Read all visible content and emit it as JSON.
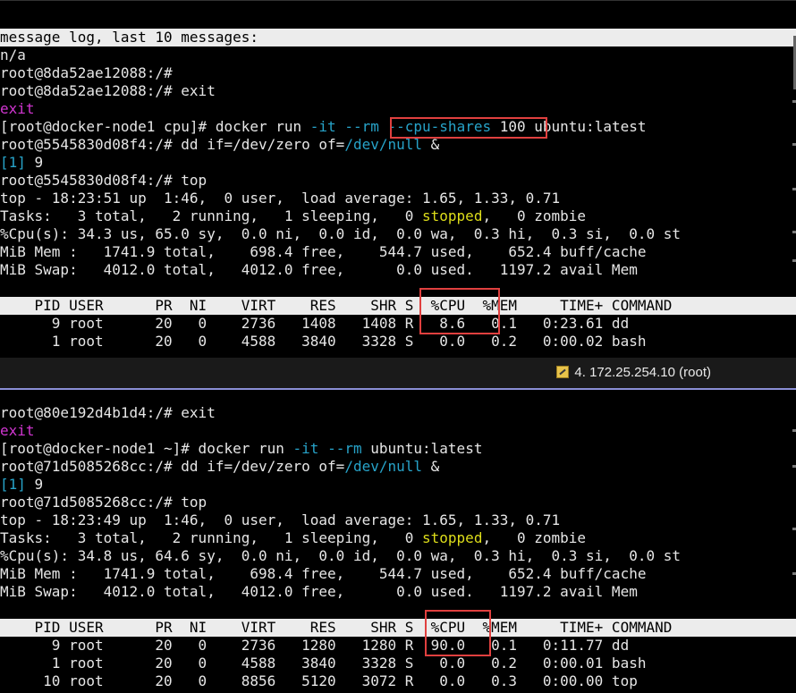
{
  "window": {
    "tab_label": "4. 172.25.254.10 (root)",
    "tab_icon": "terminal-key-icon"
  },
  "top_pane": {
    "lines": [
      {
        "text": "message log, last 10 messages:",
        "style": "hdr"
      },
      {
        "text": "n/a"
      },
      {
        "text": "root@8da52ae12088:/#"
      },
      {
        "text": "root@8da52ae12088:/# exit"
      },
      {
        "text": "exit",
        "style": "magenta"
      },
      {
        "segments": [
          {
            "text": "[root@docker-node1 cpu]# docker run "
          },
          {
            "text": "-it",
            "style": "cyan"
          },
          {
            "text": " "
          },
          {
            "text": "--rm",
            "style": "cyan"
          },
          {
            "text": " "
          },
          {
            "text": "--cpu-shares",
            "style": "cyan"
          },
          {
            "text": " 100 ubuntu:latest"
          }
        ]
      },
      {
        "segments": [
          {
            "text": "root@5545830d08f4:/# dd if=/dev/zero of="
          },
          {
            "text": "/dev/null",
            "style": "cyan"
          },
          {
            "text": " &"
          }
        ]
      },
      {
        "segments": [
          {
            "text": "[1]",
            "style": "cyan"
          },
          {
            "text": " 9"
          }
        ]
      },
      {
        "text": "root@5545830d08f4:/# top"
      },
      {
        "text": "top - 18:23:51 up  1:46,  0 user,  load average: 1.65, 1.33, 0.71"
      },
      {
        "segments": [
          {
            "text": "Tasks:   3 total,   2 running,   1 sleeping,   0 "
          },
          {
            "text": "stopped",
            "style": "yellow"
          },
          {
            "text": ",   0 zombie"
          }
        ]
      },
      {
        "text": "%Cpu(s): 34.3 us, 65.0 sy,  0.0 ni,  0.0 id,  0.0 wa,  0.3 hi,  0.3 si,  0.0 st"
      },
      {
        "text": "MiB Mem :   1741.9 total,    698.4 free,    544.7 used,    652.4 buff/cache"
      },
      {
        "text": "MiB Swap:   4012.0 total,   4012.0 free,      0.0 used.   1197.2 avail Mem"
      },
      {
        "text": ""
      },
      {
        "text": "    PID USER      PR  NI    VIRT    RES    SHR S  %CPU  %MEM     TIME+ COMMAND",
        "style": "hdr"
      },
      {
        "text": "      9 root      20   0    2736   1408   1408 R   8.6   0.1   0:23.61 dd"
      },
      {
        "text": "      1 root      20   0    4588   3840   3328 S   0.0   0.2   0:00.02 bash"
      }
    ]
  },
  "bottom_pane": {
    "lines": [
      {
        "text": "root@80e192d4b1d4:/# exit"
      },
      {
        "text": "exit",
        "style": "magenta"
      },
      {
        "segments": [
          {
            "text": "[root@docker-node1 ~]# docker run "
          },
          {
            "text": "-it",
            "style": "cyan"
          },
          {
            "text": " "
          },
          {
            "text": "--rm",
            "style": "cyan"
          },
          {
            "text": " ubuntu:latest"
          }
        ]
      },
      {
        "segments": [
          {
            "text": "root@71d5085268cc:/# dd if=/dev/zero of="
          },
          {
            "text": "/dev/null",
            "style": "cyan"
          },
          {
            "text": " &"
          }
        ]
      },
      {
        "segments": [
          {
            "text": "[1]",
            "style": "cyan"
          },
          {
            "text": " 9"
          }
        ]
      },
      {
        "text": "root@71d5085268cc:/# top"
      },
      {
        "text": "top - 18:23:49 up  1:46,  0 user,  load average: 1.65, 1.33, 0.71"
      },
      {
        "segments": [
          {
            "text": "Tasks:   3 total,   2 running,   1 sleeping,   0 "
          },
          {
            "text": "stopped",
            "style": "yellow"
          },
          {
            "text": ",   0 zombie"
          }
        ]
      },
      {
        "text": "%Cpu(s): 34.8 us, 64.6 sy,  0.0 ni,  0.0 id,  0.0 wa,  0.3 hi,  0.3 si,  0.0 st"
      },
      {
        "text": "MiB Mem :   1741.9 total,    698.4 free,    544.7 used,    652.4 buff/cache"
      },
      {
        "text": "MiB Swap:   4012.0 total,   4012.0 free,      0.0 used.   1197.2 avail Mem"
      },
      {
        "text": ""
      },
      {
        "text": "    PID USER      PR  NI    VIRT    RES    SHR S  %CPU  %MEM     TIME+ COMMAND",
        "style": "hdr"
      },
      {
        "text": "      9 root      20   0    2736   1280   1280 R  90.0   0.1   0:11.77 dd"
      },
      {
        "text": "      1 root      20   0    4588   3840   3328 S   0.0   0.2   0:00.01 bash"
      },
      {
        "text": "     10 root      20   0    8856   5120   3072 R   0.0   0.3   0:00.00 top"
      }
    ]
  },
  "colors": {
    "background": "#000000",
    "foreground": "#e6e6e6",
    "magenta": "#d136d1",
    "cyan": "#27a3c9",
    "yellow": "#dede1a",
    "highlight_box": "#e0403f",
    "header_bar": "#ececec"
  }
}
